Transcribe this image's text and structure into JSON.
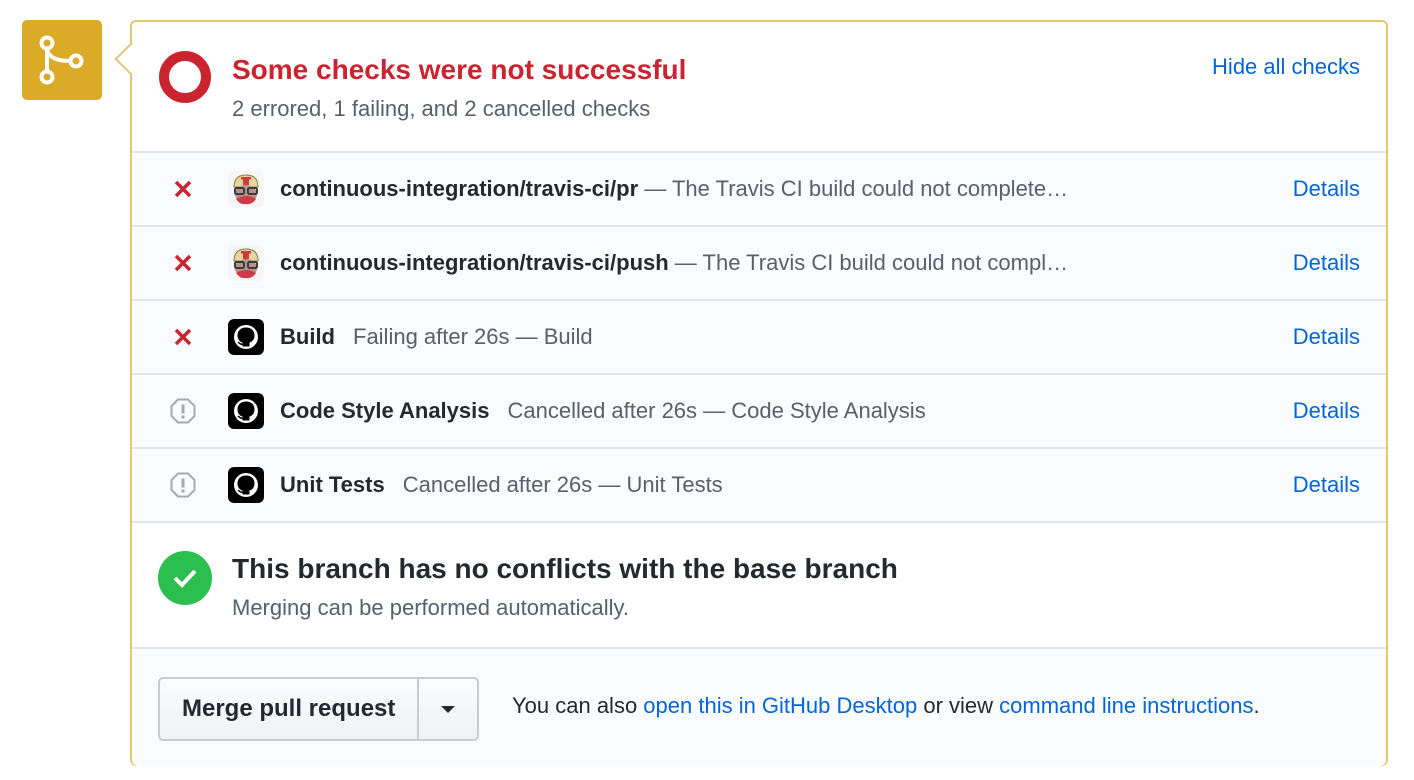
{
  "status": {
    "title": "Some checks were not successful",
    "subtitle": "2 errored, 1 failing, and 2 cancelled checks",
    "toggle_label": "Hide all checks",
    "color": "#cb2431"
  },
  "checks": [
    {
      "state": "error",
      "app": "travis-ci",
      "name": "continuous-integration/travis-ci/pr",
      "separator": " — ",
      "description": "The Travis CI build could not complete…",
      "details_label": "Details"
    },
    {
      "state": "error",
      "app": "travis-ci",
      "name": "continuous-integration/travis-ci/push",
      "separator": " — ",
      "description": "The Travis CI build could not compl…",
      "details_label": "Details"
    },
    {
      "state": "failure",
      "app": "github",
      "name": "Build",
      "separator": "",
      "description": "Failing after 26s — Build",
      "details_label": "Details"
    },
    {
      "state": "cancelled",
      "app": "github",
      "name": "Code Style Analysis",
      "separator": "",
      "description": "Cancelled after 26s — Code Style Analysis",
      "details_label": "Details"
    },
    {
      "state": "cancelled",
      "app": "github",
      "name": "Unit Tests",
      "separator": "",
      "description": "Cancelled after 26s — Unit Tests",
      "details_label": "Details"
    }
  ],
  "conflicts": {
    "title": "This branch has no conflicts with the base branch",
    "subtitle": "Merging can be performed automatically.",
    "color": "#2cbe4e"
  },
  "merge": {
    "button_label": "Merge pull request",
    "hint_prefix": "You can also ",
    "desktop_link": "open this in GitHub Desktop",
    "hint_middle": " or view ",
    "cli_link": "command line instructions",
    "hint_suffix": "."
  },
  "colors": {
    "merge_badge": "#dbab28",
    "link": "#0366d6",
    "error": "#cb2431",
    "cancelled": "#a3aab1"
  }
}
